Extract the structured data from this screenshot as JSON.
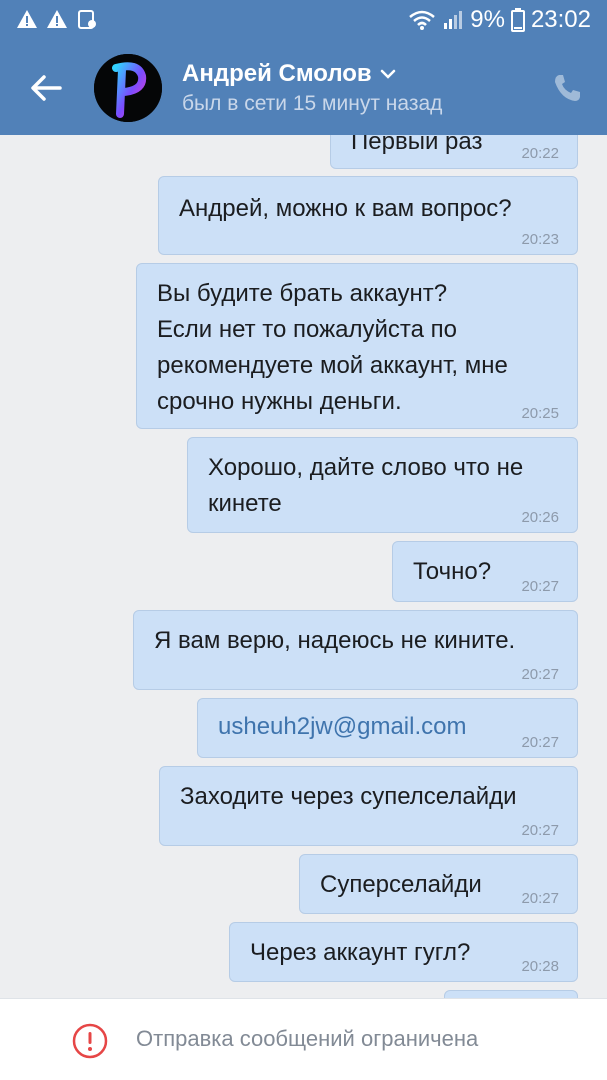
{
  "statusbar": {
    "left_icons": [
      "warning-icon",
      "warning-icon",
      "notification-icon"
    ],
    "right_icons": [
      "wifi-icon",
      "signal-icon",
      "battery-icon"
    ],
    "battery": "9%",
    "time": "23:02"
  },
  "header": {
    "contact_name": "Андрей Смолов",
    "last_seen": "был в сети 15 минут назад",
    "avatar_letter": "P"
  },
  "messages": [
    {
      "text": "Первый раз",
      "time": "20:22"
    },
    {
      "text": "Андрей, можно к вам вопрос?",
      "time": "20:23"
    },
    {
      "text": "Вы будите брать аккаунт?\nЕсли нет то пожалуйста по\nрекомендуете мой аккаунт, мне\nсрочно нужны деньги.",
      "time": "20:25"
    },
    {
      "text": "Хорошо, дайте слово что не\nкинете",
      "time": "20:26"
    },
    {
      "text": "Точно?",
      "time": "20:27"
    },
    {
      "text": "Я вам верю, надеюсь не кините.",
      "time": "20:27"
    },
    {
      "text": "usheuh2jw@gmail.com",
      "time": "20:27"
    },
    {
      "text": "Заходите через супелселайди",
      "time": "20:27"
    },
    {
      "text": "Суперселайди",
      "time": "20:27"
    },
    {
      "text": "Через аккаунт гугл?",
      "time": "20:28"
    }
  ],
  "footer": {
    "notice": "Отправка сообщений ограничена"
  },
  "colors": {
    "header": "#5181b8",
    "bubble": "#cce0f7",
    "link": "#3f74ad",
    "warning": "#e64646"
  }
}
